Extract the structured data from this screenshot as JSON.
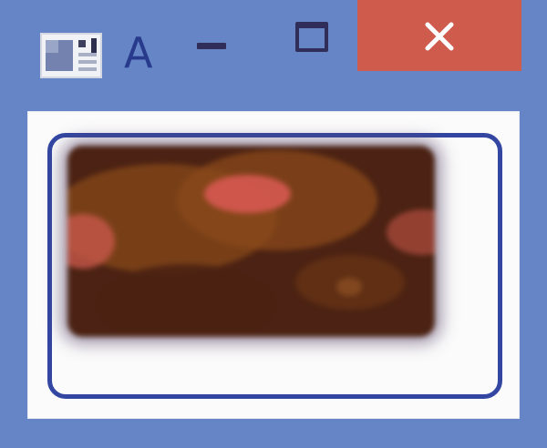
{
  "window": {
    "title": "A",
    "background_color": "#6585c6",
    "close_color": "#cf5b4d"
  },
  "titlebar": {
    "app_icon": "image-viewer-icon",
    "minimize_icon": "minimize-icon",
    "maximize_icon": "maximize-icon",
    "close_icon": "close-icon"
  },
  "content": {
    "frame_color": "#3246a2",
    "image_description_colors": [
      "#4b2213",
      "#7d4218",
      "#d2574e"
    ]
  }
}
